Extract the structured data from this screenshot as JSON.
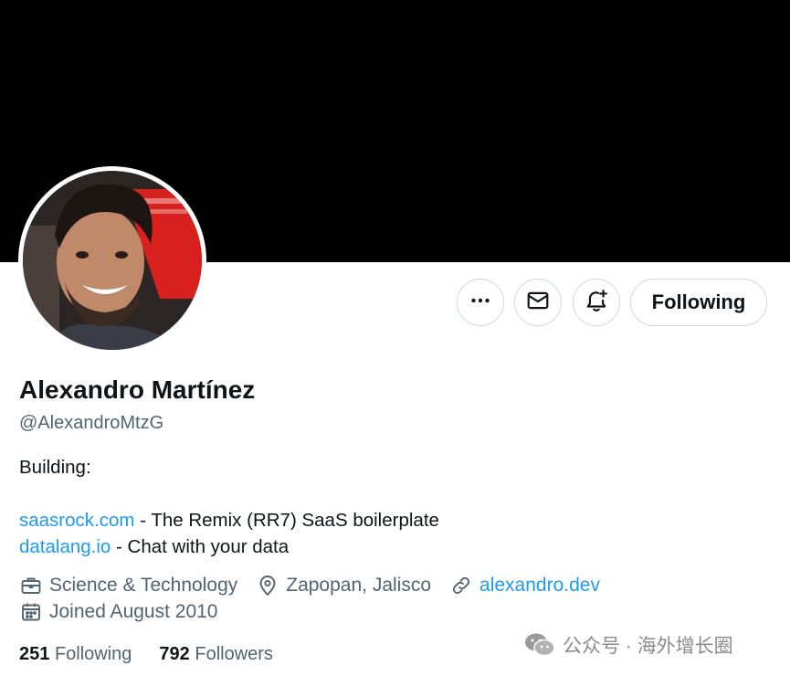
{
  "profile": {
    "name": "Alexandro Martínez",
    "handle": "@AlexandroMtzG",
    "bio": {
      "line1": "Building:",
      "link1": "saasrock.com",
      "text1": " - The Remix (RR7) SaaS boilerplate",
      "link2": "datalang.io",
      "text2": " - Chat with your data"
    },
    "category": "Science & Technology",
    "location": "Zapopan, Jalisco",
    "website": "alexandro.dev",
    "joined": "Joined August 2010"
  },
  "actions": {
    "more_icon": "more-horizontal-icon",
    "message_icon": "envelope-icon",
    "notify_icon": "bell-plus-icon",
    "follow_label": "Following"
  },
  "stats": {
    "following_count": "251",
    "following_label": "Following",
    "followers_count": "792",
    "followers_label": "Followers"
  },
  "watermark": {
    "text": "公众号 · 海外增长圈"
  },
  "colors": {
    "banner": "#000000",
    "text_primary": "#0f1419",
    "text_secondary": "#536471",
    "link": "#1d9bf0",
    "border": "#cfd9de"
  }
}
